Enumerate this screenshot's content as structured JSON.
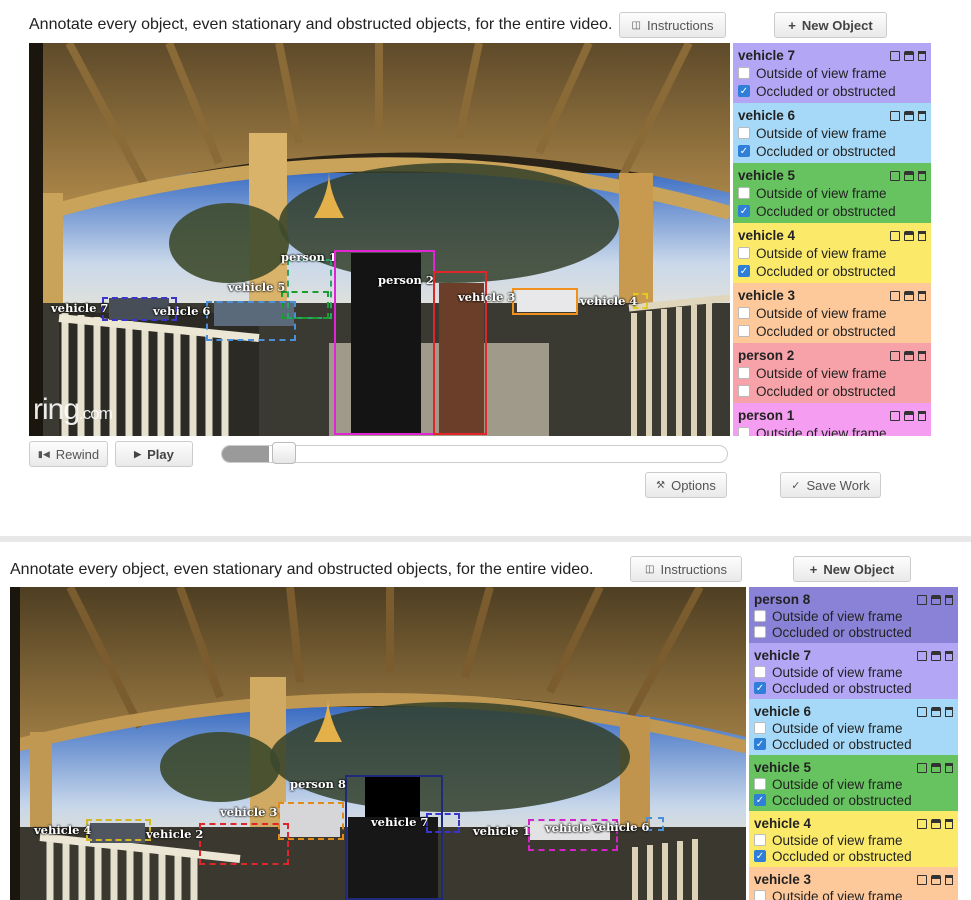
{
  "panel1": {
    "instruction": "Annotate every object, even stationary and obstructed objects, for the entire video.",
    "instructions_button": "Instructions",
    "new_object_button": "New Object",
    "rewind_button": "Rewind",
    "play_button": "Play",
    "options_button": "Options",
    "save_button": "Save Work",
    "watermark": "ring",
    "watermark_suffix": ".com",
    "scrubber_progress": 0.07,
    "boxes": [
      {
        "label": "person 1",
        "color": "#2aa36b"
      },
      {
        "label": "person 2",
        "color": "#e024d6"
      },
      {
        "label": "vehicle 3",
        "color": "#f0911d"
      },
      {
        "label": "vehicle 4",
        "color": "#e3cb20"
      },
      {
        "label": "vehicle 5",
        "color": "#1a9e2e"
      },
      {
        "label": "vehicle 6",
        "color": "#4a90d9"
      },
      {
        "label": "vehicle 7",
        "color": "#3a34c8"
      },
      {
        "label": "",
        "color": "#e0262b"
      }
    ],
    "objects": [
      {
        "name": "vehicle 7",
        "color": "#b3a7f5",
        "outside_label": "Outside of view frame",
        "occluded_label": "Occluded or obstructed",
        "outside": false,
        "occluded": true
      },
      {
        "name": "vehicle 6",
        "color": "#a6d9f7",
        "outside_label": "Outside of view frame",
        "occluded_label": "Occluded or obstructed",
        "outside": false,
        "occluded": true
      },
      {
        "name": "vehicle 5",
        "color": "#66c35f",
        "outside_label": "Outside of view frame",
        "occluded_label": "Occluded or obstructed",
        "outside": false,
        "occluded": true
      },
      {
        "name": "vehicle 4",
        "color": "#fbe96a",
        "outside_label": "Outside of view frame",
        "occluded_label": "Occluded or obstructed",
        "outside": false,
        "occluded": true
      },
      {
        "name": "vehicle 3",
        "color": "#fdc89a",
        "outside_label": "Outside of view frame",
        "occluded_label": "Occluded or obstructed",
        "outside": false,
        "occluded": false
      },
      {
        "name": "person 2",
        "color": "#f7a2a8",
        "outside_label": "Outside of view frame",
        "occluded_label": "Occluded or obstructed",
        "outside": false,
        "occluded": false
      },
      {
        "name": "person 1",
        "color": "#f59df0",
        "outside_label": "Outside of view frame",
        "occluded_label": "",
        "outside": false,
        "occluded": false
      }
    ]
  },
  "panel2": {
    "instruction": "Annotate every object, even stationary and obstructed objects, for the entire video.",
    "instructions_button": "Instructions",
    "new_object_button": "New Object",
    "boxes": [
      {
        "label": "person 8",
        "color": "#1f2a7a"
      },
      {
        "label": "vehicle 3",
        "color": "#e08a1a"
      },
      {
        "label": "vehicle 4",
        "color": "#d4b820"
      },
      {
        "label": "vehicle 2",
        "color": "#e0262b"
      },
      {
        "label": "vehicle 7",
        "color": "#3a34c8"
      },
      {
        "label": "vehicle 1",
        "color": "#e0262b"
      },
      {
        "label": "vehicle 5",
        "color": "#d424c8"
      },
      {
        "label": "vehicle 6",
        "color": "#4a90d9"
      }
    ],
    "objects": [
      {
        "name": "person 8",
        "color": "#8a82d6",
        "outside_label": "Outside of view frame",
        "occluded_label": "Occluded or obstructed",
        "outside": false,
        "occluded": false
      },
      {
        "name": "vehicle 7",
        "color": "#b3a7f5",
        "outside_label": "Outside of view frame",
        "occluded_label": "Occluded or obstructed",
        "outside": false,
        "occluded": true
      },
      {
        "name": "vehicle 6",
        "color": "#a6d9f7",
        "outside_label": "Outside of view frame",
        "occluded_label": "Occluded or obstructed",
        "outside": false,
        "occluded": true
      },
      {
        "name": "vehicle 5",
        "color": "#66c35f",
        "outside_label": "Outside of view frame",
        "occluded_label": "Occluded or obstructed",
        "outside": false,
        "occluded": true
      },
      {
        "name": "vehicle 4",
        "color": "#fbe96a",
        "outside_label": "Outside of view frame",
        "occluded_label": "Occluded or obstructed",
        "outside": false,
        "occluded": true
      },
      {
        "name": "vehicle 3",
        "color": "#fdc89a",
        "outside_label": "Outside of view frame",
        "occluded_label": "",
        "outside": false,
        "occluded": false
      }
    ]
  }
}
